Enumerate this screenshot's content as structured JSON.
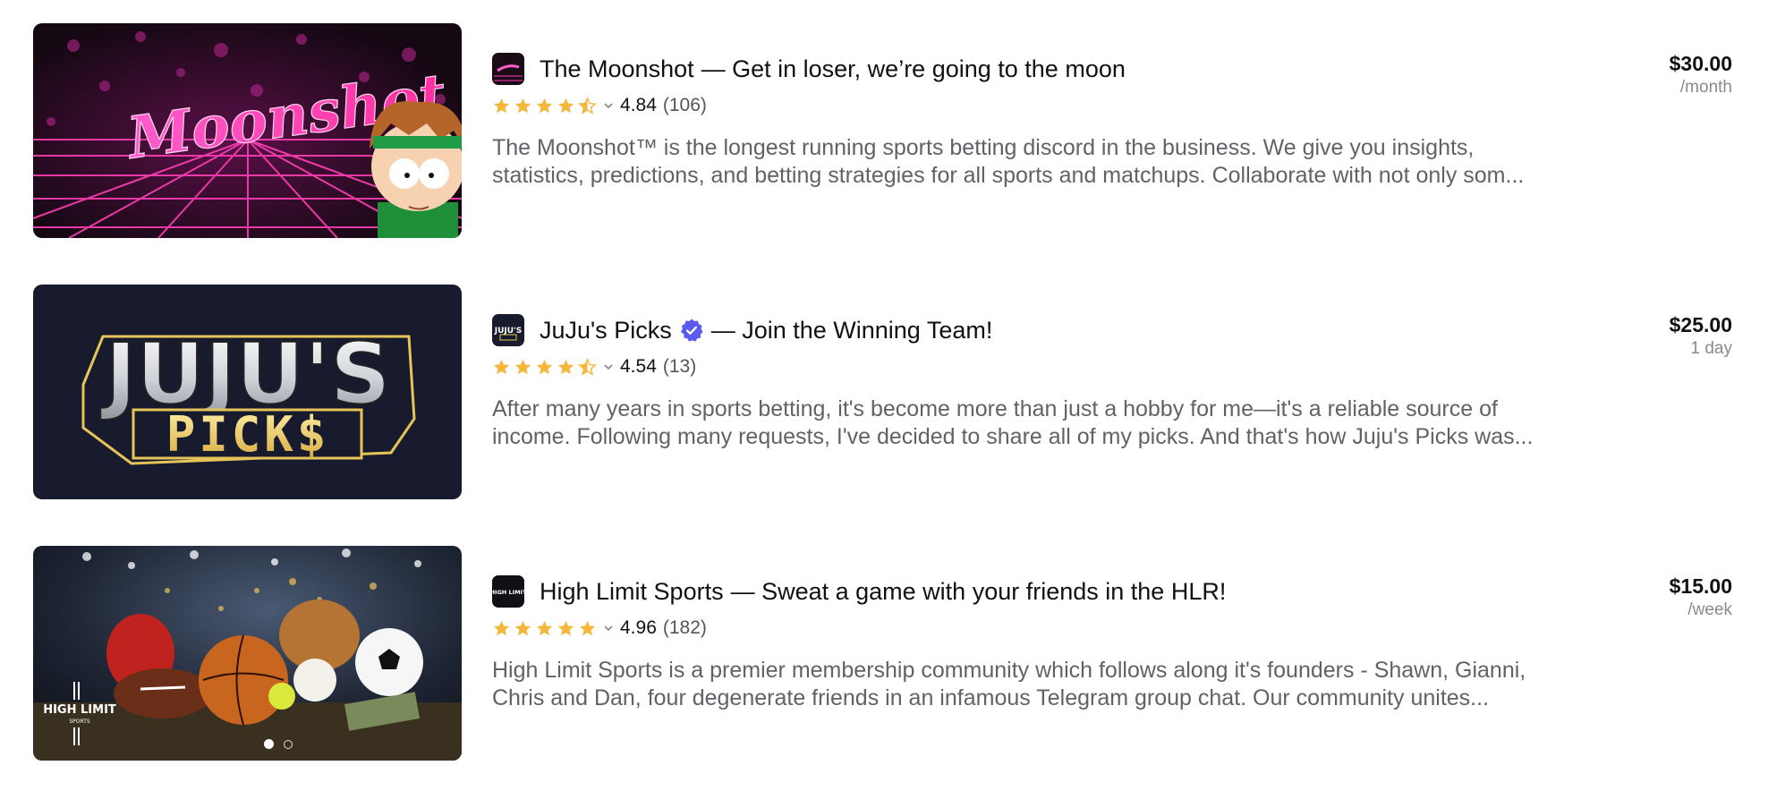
{
  "listings": [
    {
      "title": "The Moonshot",
      "tagline": "— Get in loser, we’re going to the moon",
      "verified": false,
      "rating": "4.84",
      "rating_value": 4.84,
      "review_count": "(106)",
      "description_line1": "The Moonshot™ is the longest running sports betting discord in the business. We give you insights,",
      "description_line2": "statistics, predictions, and betting strategies for all sports and matchups. Collaborate with not only som...",
      "price": "$30.00",
      "period": "/month",
      "thumbnail_text": "Moonshot",
      "logo_icon": "moonshot-logo"
    },
    {
      "title": "JuJu's Picks",
      "tagline": "— Join the Winning Team!",
      "verified": true,
      "rating": "4.54",
      "rating_value": 4.54,
      "review_count": "(13)",
      "description_line1": "After many years in sports betting, it's become more than just a hobby for me—it's a reliable source of",
      "description_line2": "income. Following many requests, I've decided to share all of my picks. And that's how Juju's Picks was...",
      "price": "$25.00",
      "period": "1 day",
      "thumbnail_text_top": "JUJU'S",
      "thumbnail_text_bottom": "PICK$",
      "logo_text": "JUJU'S",
      "logo_icon": "jujus-picks-logo"
    },
    {
      "title": "High Limit Sports",
      "tagline": "— Sweat a game with your friends in the HLR!",
      "verified": false,
      "rating": "4.96",
      "rating_value": 4.96,
      "review_count": "(182)",
      "description_line1": "High Limit Sports is a premier membership community which follows along it's founders - Shawn, Gianni,",
      "description_line2": "Chris and Dan, four degenerate friends in an infamous Telegram group chat. Our community unites...",
      "price": "$15.00",
      "period": "/week",
      "thumbnail_text_top": "HIGH LIMIT",
      "thumbnail_text_bottom": "SPORTS",
      "logo_text": "HIGH LIMIT",
      "logo_icon": "high-limit-logo",
      "carousel_slides": 2,
      "carousel_active": 1
    }
  ],
  "colors": {
    "star": "#f5b73b",
    "verified": "#5b5bf0",
    "moonshot_pink": "#ff3fb4",
    "juju_navy": "#181b2e",
    "juju_gold": "#e6c45a"
  },
  "icons": {
    "star": "star-icon",
    "half_star": "half-star-icon",
    "chevron": "chevron-down-icon",
    "verified": "verified-badge-icon"
  }
}
